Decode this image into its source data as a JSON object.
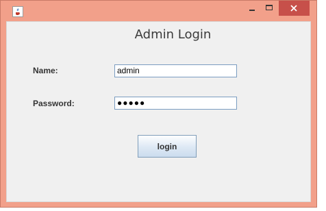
{
  "window": {
    "minimize_icon": "minimize-icon",
    "maximize_icon": "maximize-icon",
    "close_icon": "close-icon",
    "app_icon": "java-coffee-icon",
    "frame_color": "#f2a08a",
    "close_color": "#c7504a"
  },
  "form": {
    "title": "Admin Login",
    "name_label": "Name:",
    "name_value": "admin",
    "password_label": "Password:",
    "password_value": "●●●●●",
    "login_label": "login"
  }
}
